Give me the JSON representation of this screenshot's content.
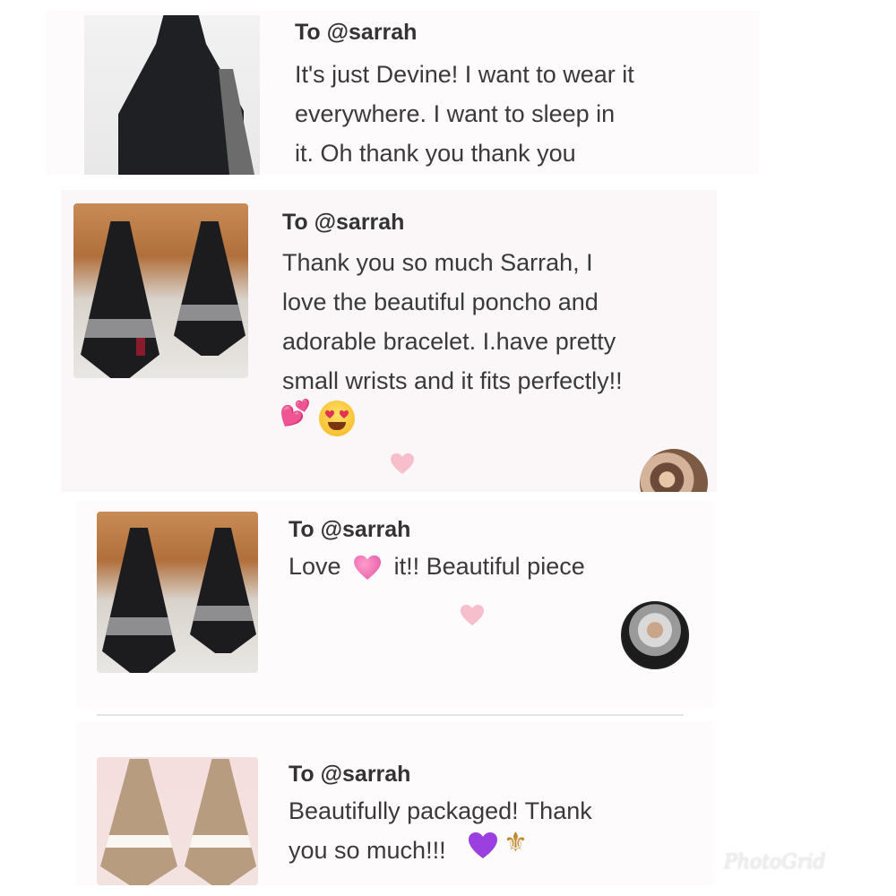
{
  "reviews": [
    {
      "to": "To @sarrah",
      "lines": [
        "It's just Devine! I want to wear it",
        "everywhere. I want to sleep in",
        "it. Oh thank you thank you"
      ]
    },
    {
      "to": "To @sarrah",
      "lines": [
        "Thank you so much Sarrah, I",
        "love the beautiful poncho and",
        "adorable bracelet. I.have pretty",
        "small wrists and it fits perfectly!!"
      ],
      "emojis": [
        "two-hearts-icon",
        "heart-eyes-smiley-icon"
      ]
    },
    {
      "to": "To @sarrah",
      "text_before": "Love",
      "text_after": "it!! Beautiful piece",
      "emojis": [
        "growing-heart-icon"
      ]
    },
    {
      "to": "To @sarrah",
      "lines": [
        "Beautifully packaged! Thank",
        "you so much!!!"
      ],
      "emojis": [
        "purple-heart-icon",
        "fleur-de-lis-icon"
      ]
    }
  ],
  "watermark": "PhotoGrid",
  "colors": {
    "like_heart": "#f6bfcb",
    "card_bg": "#fdfbfc"
  }
}
